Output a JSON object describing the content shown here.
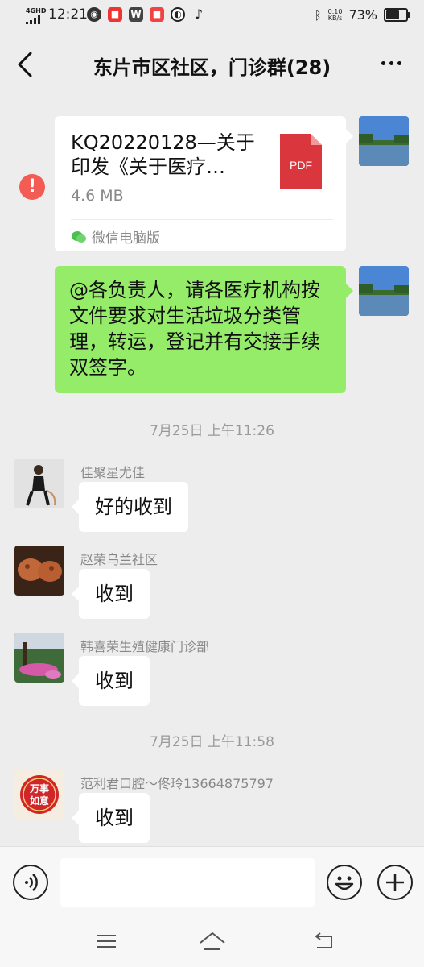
{
  "status": {
    "network": "4GHD",
    "time": "12:21",
    "speed_top": "0.10",
    "speed_unit": "KB/s",
    "battery": "73%",
    "battery_level": 0.73
  },
  "header": {
    "title": "东片市区社区，门诊群(28)"
  },
  "messages": {
    "file": {
      "title": "KQ20220128—关于印发《关于医疗…",
      "size": "4.6 MB",
      "pdf_label": "PDF",
      "source": "微信电脑版"
    },
    "text_mine": "@各负责人，请各医疗机构按文件要求对生活垃圾分类管理，转运，登记并有交接手续双签字。",
    "time1": "7月25日 上午11:26",
    "m1": {
      "sender": "佳聚星尤佳",
      "text": "好的收到"
    },
    "m2": {
      "sender": "赵荣乌兰社区",
      "text": "收到"
    },
    "m3": {
      "sender": "韩喜荣生殖健康门诊部",
      "text": "收到"
    },
    "time2": "7月25日 上午11:58",
    "m4": {
      "sender": "范利君口腔～佟玲13664875797",
      "text": "收到"
    },
    "m4_avatar_text": "万事如意"
  },
  "colors": {
    "green_bubble": "#95ec69",
    "error_red": "#f25c54",
    "pdf_red": "#d9363e"
  }
}
